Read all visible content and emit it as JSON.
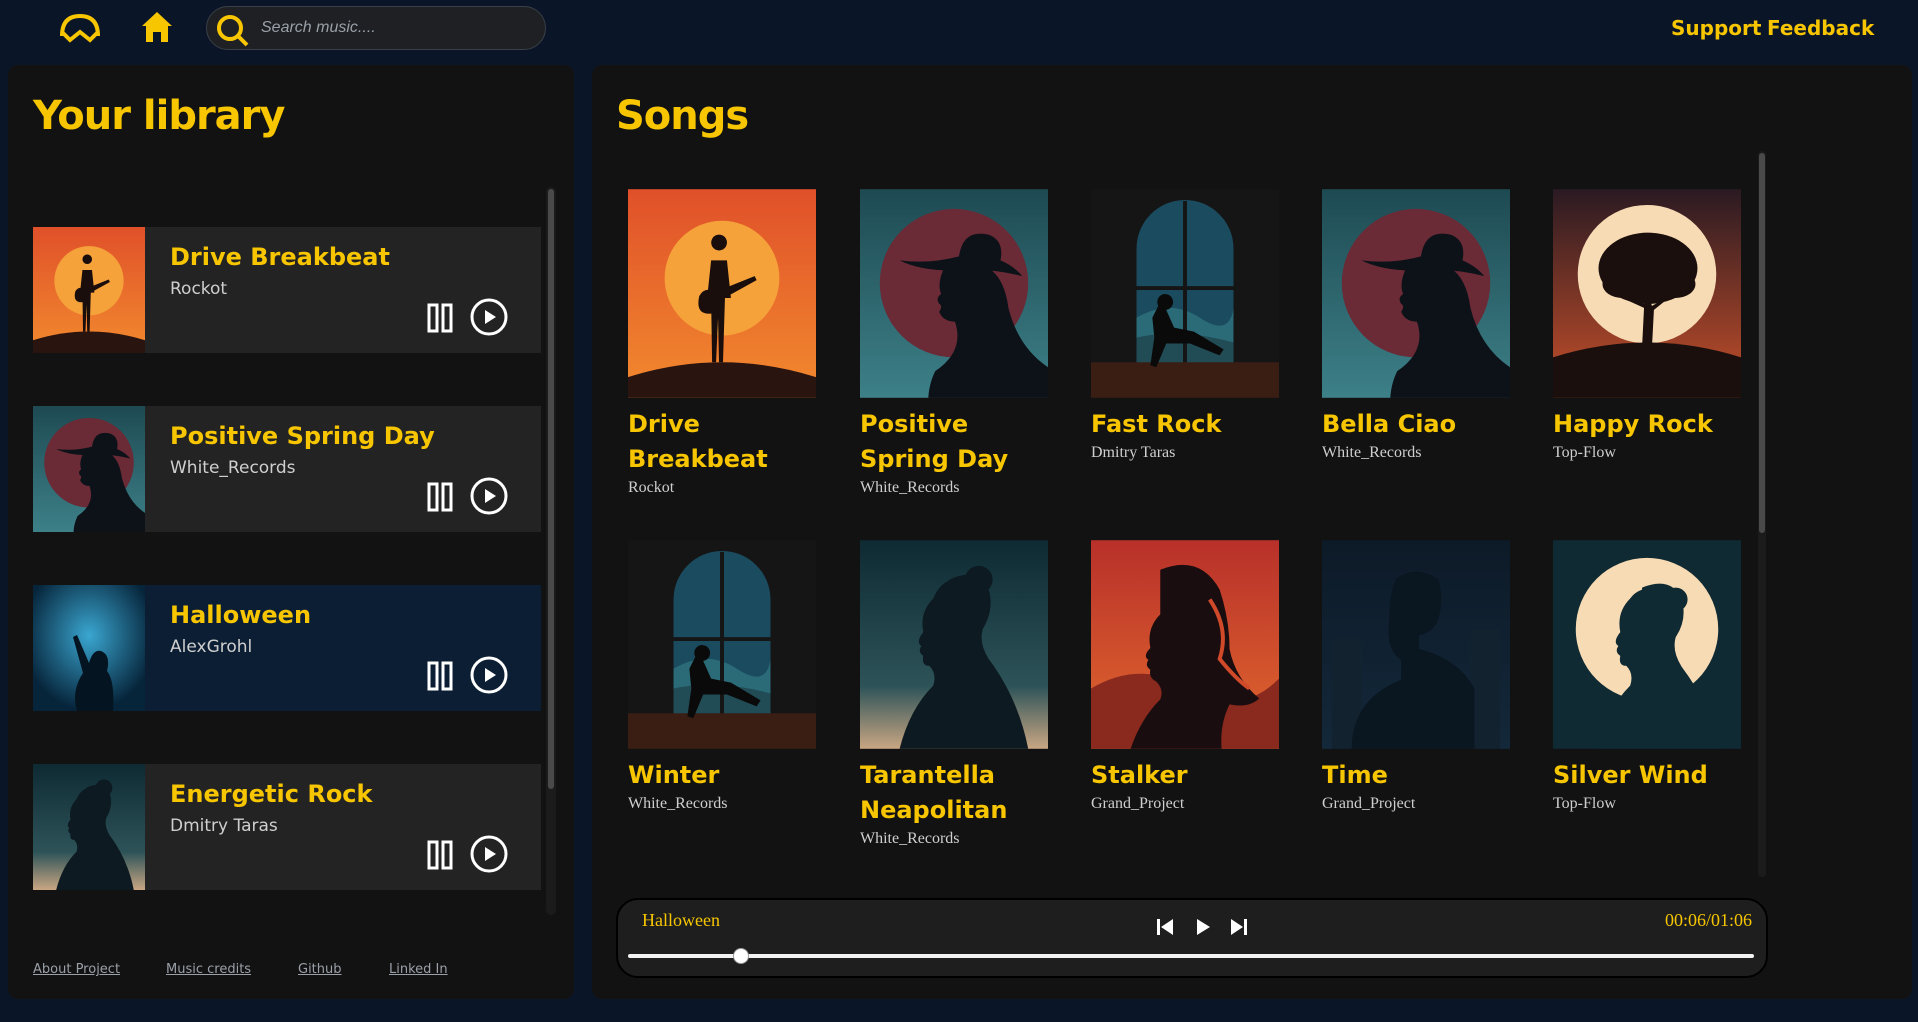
{
  "nav": {
    "search_placeholder": "Search music....",
    "support": "Support",
    "feedback": "Feedback"
  },
  "library": {
    "title": "Your library",
    "items": [
      {
        "title": "Drive Breakbeat",
        "artist": "Rockot"
      },
      {
        "title": "Positive Spring Day",
        "artist": "White_Records"
      },
      {
        "title": "Halloween",
        "artist": "AlexGrohl"
      },
      {
        "title": "Energetic Rock",
        "artist": "Dmitry Taras"
      }
    ]
  },
  "footer": {
    "about": "About Project",
    "credits": "Music credits",
    "github": "Github",
    "linkedin": "Linked In"
  },
  "songs": {
    "title": "Songs",
    "items": [
      {
        "title": "Drive Breakbeat",
        "artist": "Rockot"
      },
      {
        "title": "Positive Spring Day",
        "artist": "White_Records"
      },
      {
        "title": "Fast Rock",
        "artist": "Dmitry Taras"
      },
      {
        "title": "Bella Ciao",
        "artist": "White_Records"
      },
      {
        "title": "Happy Rock",
        "artist": "Top-Flow"
      },
      {
        "title": "Winter",
        "artist": "White_Records"
      },
      {
        "title": "Tarantella Neapolitan",
        "artist": "White_Records"
      },
      {
        "title": "Stalker",
        "artist": "Grand_Project"
      },
      {
        "title": "Time",
        "artist": "Grand_Project"
      },
      {
        "title": "Silver Wind",
        "artist": "Top-Flow"
      }
    ]
  },
  "player": {
    "title": "Halloween",
    "time": "00:06/01:06",
    "progress": 0.1
  },
  "colors": {
    "accent": "#f7c600",
    "background": "#0a1628",
    "panel": "#121212"
  }
}
